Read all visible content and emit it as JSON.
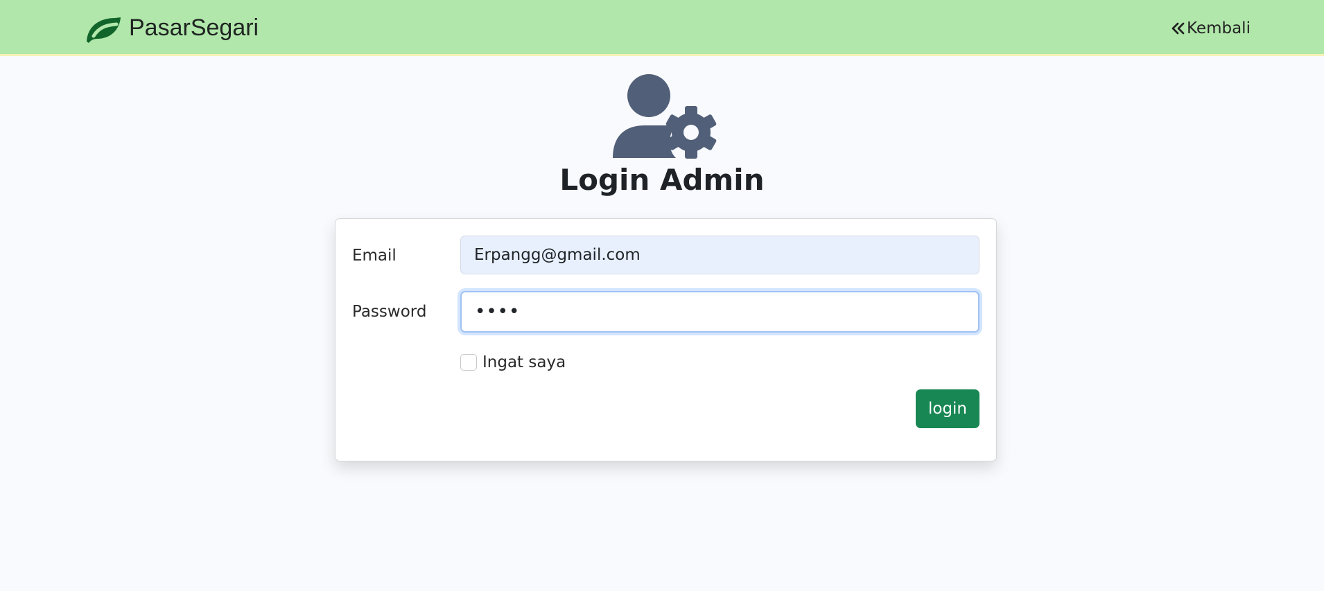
{
  "navbar": {
    "brand_icon": "leaf-icon",
    "brand_name": "PasarSegari",
    "back_icon": "double-chevron-left-icon",
    "back_label": "Kembali",
    "background_color": "#b1e7ab",
    "brand_color": "#12652a"
  },
  "header": {
    "icon": "user-gear-icon",
    "title": "Login Admin",
    "icon_color": "#525f78"
  },
  "form": {
    "email": {
      "label": "Email",
      "value": "Erpangg@gmail.com"
    },
    "password": {
      "label": "Password",
      "value": "••••"
    },
    "remember": {
      "label": "Ingat saya"
    },
    "submit_label": "login",
    "submit_color": "#198754"
  }
}
